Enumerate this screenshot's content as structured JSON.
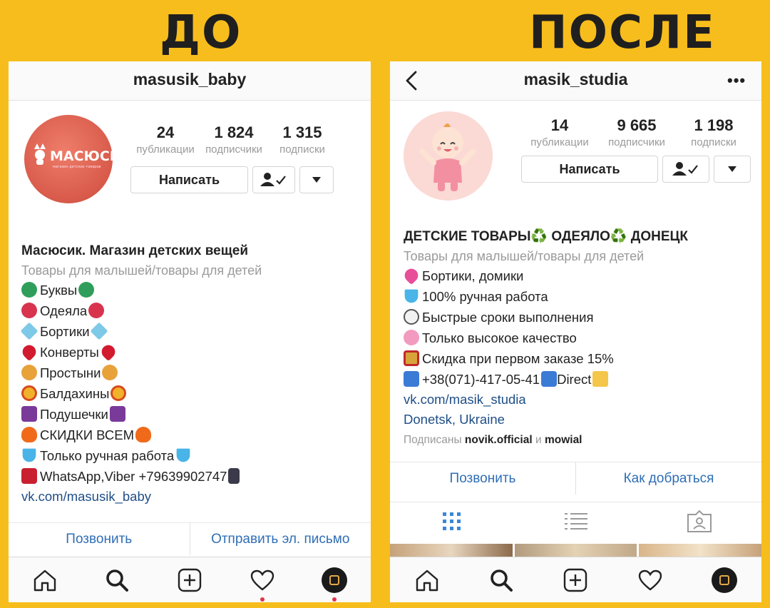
{
  "headings": {
    "before": "ДО",
    "after": "ПОСЛЕ"
  },
  "before": {
    "username": "masusik_baby",
    "logo_text": "МАСЮСИК",
    "logo_subtext": "магазин детских товаров",
    "stats": [
      {
        "num": "24",
        "label": "публикации"
      },
      {
        "num": "1 824",
        "label": "подписчики"
      },
      {
        "num": "1 315",
        "label": "подписки"
      }
    ],
    "message_button": "Написать",
    "bio_title": "Масюсик. Магазин детских вещей",
    "category": "Товары для малышей/товары для детей",
    "lines": [
      {
        "icon": "recycle",
        "text": "Буквы",
        "icon_after": "recycle"
      },
      {
        "icon": "flower",
        "text": "Одеяла",
        "icon_after": "flower"
      },
      {
        "icon": "diamond",
        "text": "Бортики",
        "icon_after": "diamond"
      },
      {
        "icon": "heart",
        "text": "Конверты",
        "icon_after": "heart"
      },
      {
        "icon": "bouquet",
        "text": "Простыни",
        "icon_after": "bouquet"
      },
      {
        "icon": "dharma",
        "text": "Балдахины",
        "icon_after": "dharma"
      },
      {
        "icon": "moon",
        "text": "Подушечки",
        "icon_after": "moon"
      },
      {
        "icon": "fire",
        "text": "СКИДКИ ВСЕМ",
        "icon_after": "fire"
      },
      {
        "icon": "gem",
        "text": "Только ручная работа",
        "icon_after": "gem"
      },
      {
        "icon": "phone-e",
        "text": "WhatsApp,Viber +79639902747",
        "icon_after": "mobile"
      }
    ],
    "link": "vk.com/masusik_baby",
    "actions": [
      "Позвонить",
      "Отправить эл. письмо"
    ]
  },
  "after": {
    "username": "masik_studia",
    "stats": [
      {
        "num": "14",
        "label": "публикации"
      },
      {
        "num": "9 665",
        "label": "подписчики"
      },
      {
        "num": "1 198",
        "label": "подписки"
      }
    ],
    "message_button": "Написать",
    "bio_title": "ДЕТСКИЕ ТОВАРЫ♻️ ОДЕЯЛО♻️ ДОНЕЦК",
    "category": "Товары для малышей/товары для детей",
    "lines": [
      {
        "icon": "pinkheart",
        "text": "Бортики, домики"
      },
      {
        "icon": "gem",
        "text": "100% ручная работа"
      },
      {
        "icon": "clock",
        "text": "Быстрые сроки выполнения"
      },
      {
        "icon": "cherry",
        "text": "Только высокое качество"
      },
      {
        "icon": "gift",
        "text": "Скидка при первом заказе 15%"
      },
      {
        "icon": "arrowr",
        "text": "+38(071)-417-05-41",
        "icon_after": "arrowdl",
        "text_after": "Direct"
      }
    ],
    "link": "vk.com/masik_studia",
    "location": "Donetsk, Ukraine",
    "followed_prefix": "Подписаны",
    "followed_user1": "novik.official",
    "followed_and": "и",
    "followed_user2": "mowial",
    "actions": [
      "Позвонить",
      "Как добраться"
    ]
  }
}
